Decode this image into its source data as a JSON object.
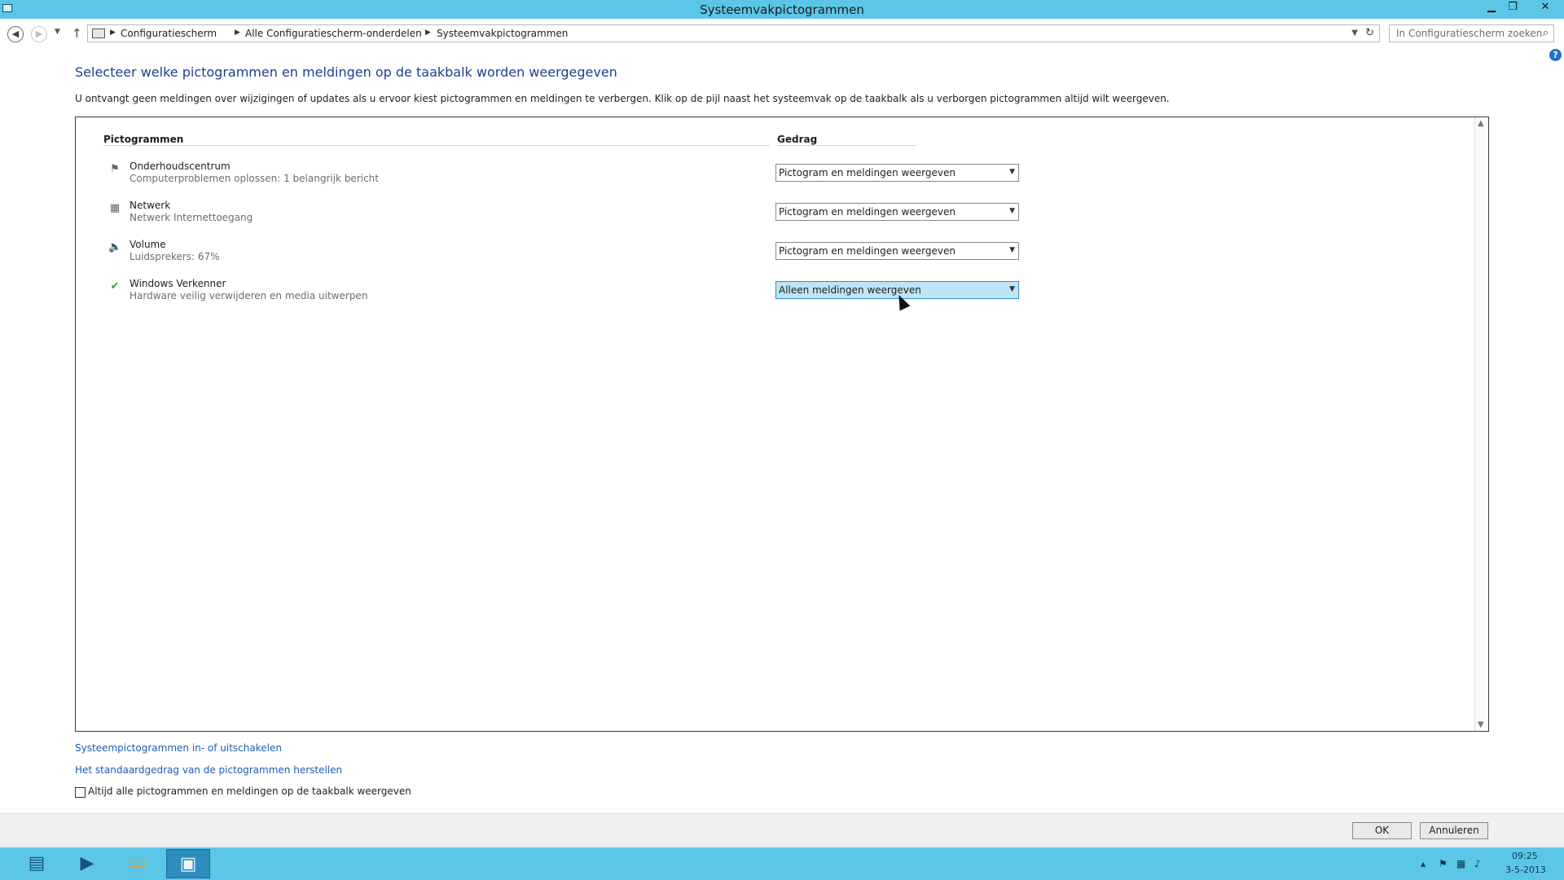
{
  "window": {
    "title": "Systeemvakpictogrammen",
    "minimize_glyph": "▁",
    "maximize_glyph": "❐",
    "close_glyph": "✕"
  },
  "nav": {
    "breadcrumb": [
      "Configuratiescherm",
      "Alle Configuratiescherm-onderdelen",
      "Systeemvakpictogrammen"
    ],
    "search_placeholder": "In Configuratiescherm zoeken"
  },
  "main": {
    "heading": "Selecteer welke pictogrammen en meldingen op de taakbalk worden weergegeven",
    "description": "U ontvangt geen meldingen over wijzigingen of updates als u ervoor kiest pictogrammen en meldingen te verbergen. Klik op de pijl naast het systeemvak op de taakbalk als u verborgen pictogrammen altijd wilt weergeven.",
    "columns": {
      "icons": "Pictogrammen",
      "behavior": "Gedrag"
    },
    "rows": [
      {
        "title": "Onderhoudscentrum",
        "subtitle": "Computerproblemen oplossen: 1 belangrijk bericht",
        "behavior": "Pictogram en meldingen weergeven",
        "icon": "flag-icon"
      },
      {
        "title": "Netwerk",
        "subtitle": "Netwerk Internettoegang",
        "behavior": "Pictogram en meldingen weergeven",
        "icon": "network-icon"
      },
      {
        "title": "Volume",
        "subtitle": "Luidsprekers: 67%",
        "behavior": "Pictogram en meldingen weergeven",
        "icon": "speaker-icon"
      },
      {
        "title": "Windows Verkenner",
        "subtitle": "Hardware veilig verwijderen en media uitwerpen",
        "behavior": "Alleen meldingen weergeven",
        "icon": "usb-eject-icon"
      }
    ]
  },
  "links": {
    "system_icons": "Systeempictogrammen in- of uitschakelen",
    "restore_default": "Het standaardgedrag van de pictogrammen herstellen"
  },
  "checkbox": {
    "label": "Altijd alle pictogrammen en meldingen op de taakbalk weergeven",
    "checked": false
  },
  "buttons": {
    "ok": "OK",
    "cancel": "Annuleren"
  },
  "taskbar": {
    "time": "09:25",
    "date": "3-5-2013"
  },
  "colors": {
    "accent": "#5bc6e8",
    "heading": "#1e3e8e",
    "link": "#1e5bb8",
    "selected_dropdown": "#bde4f7"
  }
}
